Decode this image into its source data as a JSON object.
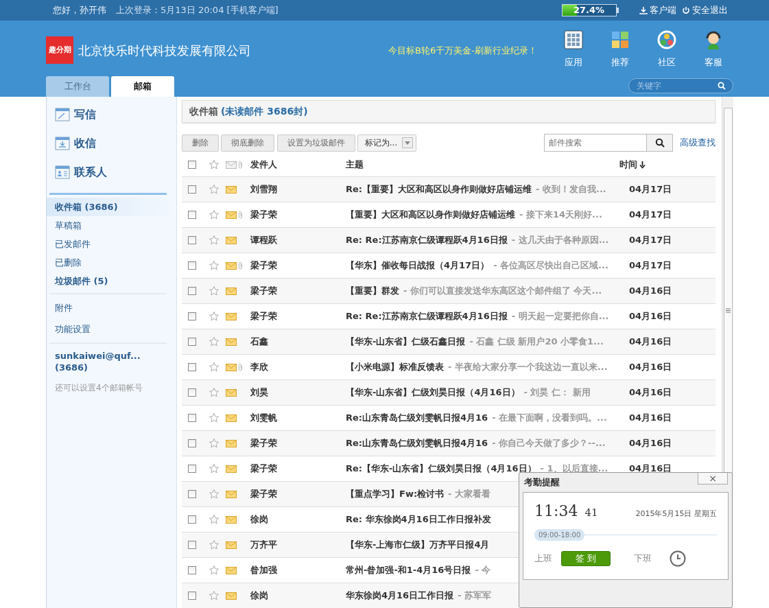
{
  "top_bar": {
    "greeting": "您好，孙开伟",
    "last_login": "上次登录：5月13日 20:04 [手机客户端]",
    "usage": {
      "level": 0.274,
      "reading": "27.4%"
    },
    "links": [
      {
        "kind": "download",
        "label": "客户端"
      },
      {
        "kind": "power",
        "label": "安全退出"
      }
    ]
  },
  "header": {
    "logo": "趣分期",
    "company": "北京快乐时代科技发展有限公司",
    "slogan": "今目标B轮6千万美金-刷新行业纪录！",
    "nav": [
      {
        "kind": "apps",
        "label": "应用"
      },
      {
        "kind": "recommend",
        "label": "推荐"
      },
      {
        "kind": "community",
        "label": "社区"
      },
      {
        "kind": "service",
        "label": "客服"
      }
    ],
    "tabs": [
      {
        "label": "工作台",
        "selected": false
      },
      {
        "label": "邮箱",
        "selected": true
      }
    ],
    "search": {
      "placeholder": "关键字"
    }
  },
  "sidebar": {
    "actions": [
      {
        "kind": "compose",
        "label": "写信"
      },
      {
        "kind": "receive",
        "label": "收信"
      },
      {
        "kind": "contacts",
        "label": "联系人"
      }
    ],
    "folders": [
      {
        "label": "收件箱 (3686)",
        "selected": true,
        "bold": true
      },
      {
        "label": "草稿箱",
        "selected": false,
        "bold": false
      },
      {
        "label": "已发邮件",
        "selected": false,
        "bold": false
      },
      {
        "label": "已删除",
        "selected": false,
        "bold": false
      },
      {
        "label": "垃圾邮件 (5)",
        "selected": false,
        "bold": true
      }
    ],
    "tools": [
      "附件",
      "功能设置"
    ],
    "account": {
      "address": "sunkaiwei@quf...",
      "count": "(3686)"
    },
    "note": "还可以设置4个邮箱帐号"
  },
  "mailbox": {
    "title": "收件箱",
    "unread": "(未读邮件 3686封)",
    "buttons": [
      {
        "kind": "button",
        "label": "删除"
      },
      {
        "kind": "button",
        "label": "彻底删除"
      },
      {
        "kind": "button",
        "label": "设置为垃圾邮件"
      },
      {
        "kind": "dropdown",
        "label": "标记为..."
      }
    ],
    "search": {
      "placeholder": "邮件搜索"
    },
    "advanced": "高级查找",
    "select_all": {
      "checked": false
    },
    "columns": [
      "发件人",
      "主题",
      "时间"
    ],
    "emails": [
      {
        "sender": "刘雪翔",
        "subject": "Re:【重要】大区和高区以身作则做好店铺运维",
        "preview": "- 收到！发自我...",
        "date": "04月17日",
        "attachment": false,
        "unread": true,
        "checked": false,
        "starred": false
      },
      {
        "sender": "梁子荣",
        "subject": "【重要】大区和高区以身作则做好店铺运维",
        "preview": "- 接下来14天刚好...",
        "date": "04月17日",
        "attachment": true,
        "unread": true,
        "checked": false,
        "starred": false
      },
      {
        "sender": "谭程跃",
        "subject": "Re: Re:江苏南京仁级谭程跃4月16日报",
        "preview": "- 这几天由于各种原因...",
        "date": "04月17日",
        "attachment": false,
        "unread": true,
        "checked": false,
        "starred": false
      },
      {
        "sender": "梁子荣",
        "subject": "【华东】催收每日战报（4月17日）",
        "preview": "- 各位高区尽快出自己区域...",
        "date": "04月17日",
        "attachment": true,
        "unread": true,
        "checked": false,
        "starred": false
      },
      {
        "sender": "梁子荣",
        "subject": "【重要】群发",
        "preview": "- 你们可以直接发送华东高区这个邮件组了 今天...",
        "date": "04月16日",
        "attachment": false,
        "unread": true,
        "checked": false,
        "starred": false
      },
      {
        "sender": "梁子荣",
        "subject": "Re: Re:江苏南京仁级谭程跃4月16日报",
        "preview": "- 明天起一定要把你自...",
        "date": "04月16日",
        "attachment": false,
        "unread": true,
        "checked": false,
        "starred": false
      },
      {
        "sender": "石鑫",
        "subject": "【华东-山东省】仁级石鑫日报",
        "preview": "- 石鑫 仁级 新用户20 小零食1...",
        "date": "04月16日",
        "attachment": false,
        "unread": true,
        "checked": false,
        "starred": false
      },
      {
        "sender": "李欣",
        "subject": "【小米电源】标准反馈表",
        "preview": "- 半夜给大家分享一个我这边一直以来...",
        "date": "04月16日",
        "attachment": true,
        "unread": true,
        "checked": false,
        "starred": false
      },
      {
        "sender": "刘昊",
        "subject": "【华东-山东省】仁级刘昊日报（4月16日）",
        "preview": "- 刘昊 仁： 新用",
        "date": "04月16日",
        "attachment": false,
        "unread": true,
        "checked": false,
        "starred": false
      },
      {
        "sender": "刘雯帆",
        "subject": "Re:山东青岛仁级刘雯帆日报4月16",
        "preview": "- 在最下面啊，没看到吗。...",
        "date": "04月16日",
        "attachment": false,
        "unread": true,
        "checked": false,
        "starred": false
      },
      {
        "sender": "梁子荣",
        "subject": "Re:山东青岛仁级刘雯帆日报4月16",
        "preview": "- 你自己今天做了多少？--...",
        "date": "04月16日",
        "attachment": false,
        "unread": true,
        "checked": false,
        "starred": false
      },
      {
        "sender": "梁子荣",
        "subject": "Re:【华东-山东省】仁级刘昊日报（4月16日）",
        "preview": "- 1、以后直接...",
        "date": "04月16日",
        "attachment": false,
        "unread": true,
        "checked": false,
        "starred": false
      },
      {
        "sender": "梁子荣",
        "subject": "【重点学习】Fw:检讨书",
        "preview": "- 大家看看",
        "attachment": false,
        "unread": true,
        "checked": false,
        "starred": false
      },
      {
        "sender": "徐岗",
        "subject": "Re: 华东徐岗4月16日工作日报补发",
        "attachment": false,
        "unread": true,
        "checked": false,
        "starred": false
      },
      {
        "sender": "万齐平",
        "subject": "【华东-上海市仁级】万齐平日报4月",
        "attachment": false,
        "unread": true,
        "checked": false,
        "starred": false
      },
      {
        "sender": "昝加强",
        "subject": "常州-昝加强-和1-4月16号日报",
        "preview": "- 今",
        "attachment": false,
        "unread": true,
        "checked": false,
        "starred": false
      },
      {
        "sender": "徐岗",
        "subject": "华东徐岗4月16日工作日报",
        "preview": "- 苏军军",
        "attachment": false,
        "unread": true,
        "checked": false,
        "starred": false
      }
    ]
  },
  "attendance": {
    "title": "考勤提醒",
    "close": "×",
    "time": "11:34",
    "seconds": "41",
    "date": "2015年5月15日  星期五",
    "hours": "09:00-18:00",
    "start_label": "上班",
    "check_in": "签 到",
    "end_label": "下班"
  }
}
